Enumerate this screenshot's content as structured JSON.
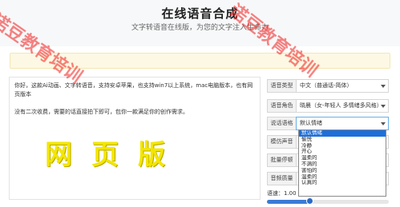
{
  "header": {
    "title": "在线语音合成",
    "subtitle": "文字转语音在线版，为您的文字注入生命力"
  },
  "text_panel": {
    "paragraph1": "你好，这款Ai动画、文字转语音，支持安卓苹果，也支持win7以上系统，mac电脑版本，也有网页版本",
    "paragraph2": "没有二次收费，需要的话直接拍下即可，包你一款满足你的创作需求。"
  },
  "settings": [
    {
      "label": "语音类型",
      "value": "中文（普通话-简体）"
    },
    {
      "label": "语音角色",
      "value": "晓晨（女-年轻人 多情绪多风格）"
    },
    {
      "label": "说话语格",
      "value": "默认情绪"
    },
    {
      "label": "模仿声音",
      "value": ""
    },
    {
      "label": "批量停顿",
      "value": ""
    },
    {
      "label": "音频质量",
      "value": ""
    }
  ],
  "style_dropdown": {
    "options": [
      "默认情绪",
      "愉悦",
      "冷静",
      "开心",
      "温柔的",
      "不满的",
      "害怕的",
      "温柔的",
      "认真的"
    ],
    "selected_index": 0
  },
  "speed": {
    "label": "语速：1.00",
    "value": 1.0,
    "fraction": 0.35
  },
  "watermarks": {
    "big": "网页版",
    "diag_left": "诺豆教育培训",
    "diag_right": "诺豆教育培训"
  },
  "colors": {
    "accent": "#3a7bd5",
    "notice_bg": "#fcf8e3",
    "watermark_red": "#f01e1e",
    "watermark_yellow": "#f3e600"
  }
}
